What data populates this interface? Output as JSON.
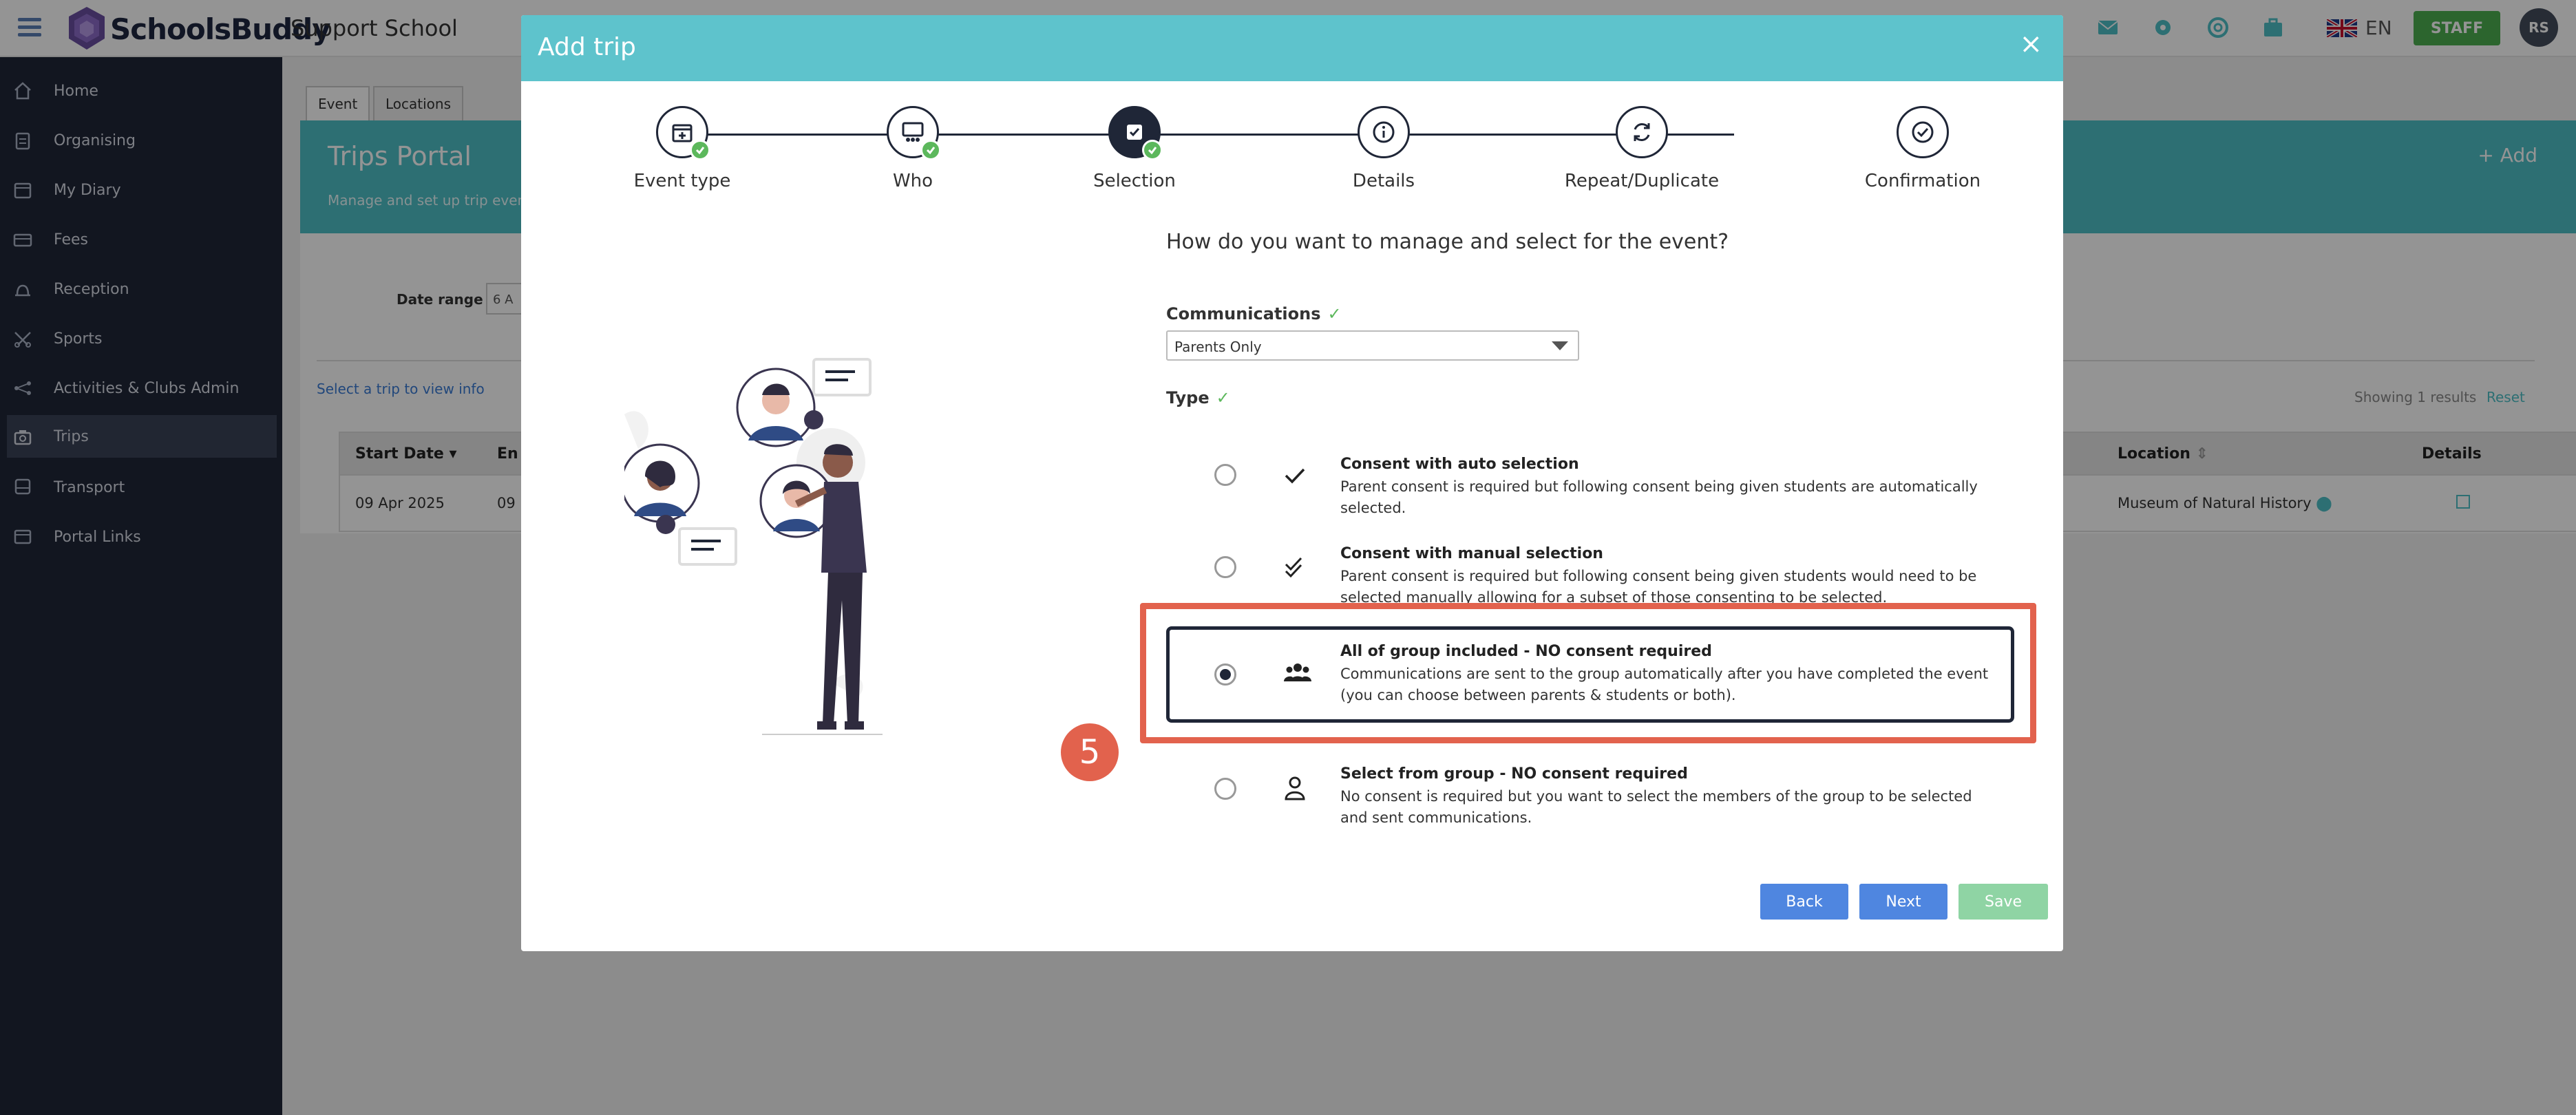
{
  "topbar": {
    "brand": "SchoolsBuddy",
    "school_name": "Support School",
    "language": "EN",
    "staff_label": "STAFF",
    "user_initials": "RS"
  },
  "sidebar": {
    "items": [
      {
        "label": "Home",
        "icon": "home-icon"
      },
      {
        "label": "Organising",
        "icon": "clipboard-icon"
      },
      {
        "label": "My Diary",
        "icon": "calendar-icon"
      },
      {
        "label": "Fees",
        "icon": "fees-icon"
      },
      {
        "label": "Reception",
        "icon": "bell-icon"
      },
      {
        "label": "Sports",
        "icon": "sports-icon"
      },
      {
        "label": "Activities & Clubs Admin",
        "icon": "activities-icon"
      },
      {
        "label": "Trips",
        "icon": "trips-icon"
      },
      {
        "label": "Transport",
        "icon": "bus-icon"
      },
      {
        "label": "Portal Links",
        "icon": "links-icon"
      }
    ],
    "active": "Trips"
  },
  "page": {
    "tabs": [
      "Event",
      "Locations"
    ],
    "title": "Trips Portal",
    "subtitle": "Manage and set up trip events",
    "add_label": "+ Add",
    "date_range_label": "Date range",
    "date_range_value": "6 A",
    "select_info": "Select a trip to view info",
    "showing": "Showing 1 results",
    "reset": "Reset",
    "columns": {
      "start_date": "Start Date",
      "end": "En",
      "location": "Location",
      "details": "Details"
    },
    "rows": [
      {
        "start_date": "09 Apr 2025",
        "end": "09",
        "location": "Museum of Natural History"
      }
    ]
  },
  "modal": {
    "title": "Add trip",
    "close": "×",
    "steps": [
      {
        "label": "Event type",
        "state": "done"
      },
      {
        "label": "Who",
        "state": "done"
      },
      {
        "label": "Selection",
        "state": "current"
      },
      {
        "label": "Details",
        "state": "todo"
      },
      {
        "label": "Repeat/Duplicate",
        "state": "todo"
      },
      {
        "label": "Confirmation",
        "state": "todo"
      }
    ],
    "question": "How do you want to manage and select for the event?",
    "communications_label": "Communications",
    "communications_value": "Parents Only",
    "type_label": "Type",
    "tick": "✓",
    "options": [
      {
        "title": "Consent with auto selection",
        "desc": "Parent consent is required but following consent being given students are automatically selected.",
        "selected": false
      },
      {
        "title": "Consent with manual selection",
        "desc": "Parent consent is required but following consent being given students would need to be selected manually allowing for a subset of those consenting to be selected.",
        "selected": false
      },
      {
        "title": "All of group included - NO consent required",
        "desc": "Communications are sent to the group automatically after you have completed the event (you can choose between parents & students or both).",
        "selected": true
      },
      {
        "title": "Select from group - NO consent required",
        "desc": "No consent is required but you want to select the members of the group to be selected and sent communications.",
        "selected": false
      }
    ],
    "buttons": {
      "back": "Back",
      "next": "Next",
      "save": "Save"
    }
  },
  "annotation": {
    "number": "5"
  },
  "colors": {
    "teal": "#5ec3cc",
    "navy": "#1f2637",
    "blue_button": "#4f86e0",
    "save_button": "#8fd4a4",
    "annotation": "#e2624d",
    "staff": "#4caf50"
  }
}
